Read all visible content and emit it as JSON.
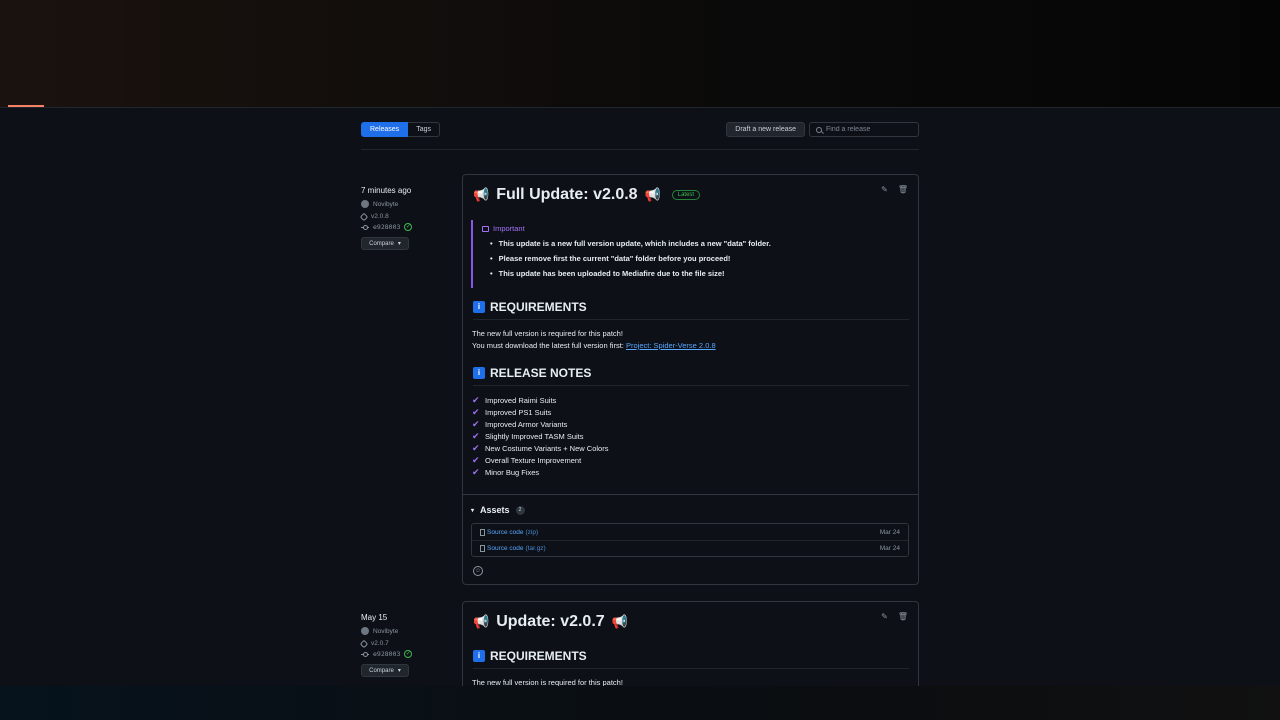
{
  "subnav": {
    "tabs": [
      "Releases",
      "Tags"
    ],
    "draft_label": "Draft a new release",
    "search_placeholder": "Find a release"
  },
  "releases": [
    {
      "date": "7 minutes ago",
      "author": "Novibyte",
      "tag": "v2.0.8",
      "commit": "e928003",
      "compare_label": "Compare",
      "title": "Full Update: v2.0.8",
      "badge": "Latest",
      "alert": {
        "title": "Important",
        "items": [
          "This update is a new full version update, which includes a new \"data\" folder.",
          "Please remove first the current \"data\" folder before you proceed!",
          "This update has been uploaded to Mediafire due to the file size!"
        ]
      },
      "requirements": {
        "heading": "REQUIREMENTS",
        "line1": "The new full version is required for this patch!",
        "line2_prefix": "You must download the latest full version first: ",
        "link": "Project: Spider-Verse 2.0.8"
      },
      "notes": {
        "heading": "RELEASE NOTES",
        "items": [
          "Improved Raimi Suits",
          "Improved PS1 Suits",
          "Improved Armor Variants",
          "Slightly Improved TASM Suits",
          "New Costume Variants + New Colors",
          "Overall Texture Improvement",
          "Minor Bug Fixes"
        ]
      },
      "assets": {
        "heading": "Assets",
        "count": "2",
        "items": [
          {
            "name": "Source code",
            "ext": "(zip)",
            "date": "Mar 24"
          },
          {
            "name": "Source code",
            "ext": "(tar.gz)",
            "date": "Mar 24"
          }
        ]
      }
    },
    {
      "date": "May 15",
      "author": "Novibyte",
      "tag": "v2.0.7",
      "commit": "e928003",
      "compare_label": "Compare",
      "title": "Update: v2.0.7",
      "requirements": {
        "heading": "REQUIREMENTS",
        "line1": "The new full version is required for this patch!"
      }
    }
  ],
  "icons": {
    "megaphone": "📢",
    "info": "i",
    "check": "✔",
    "pencil": "✎",
    "trash": "🗑",
    "smiley": "☺"
  },
  "colors": {
    "accent": "#1f6feb",
    "latest": "#3fb950",
    "alert": "#a371f7",
    "link": "#58a6ff"
  }
}
